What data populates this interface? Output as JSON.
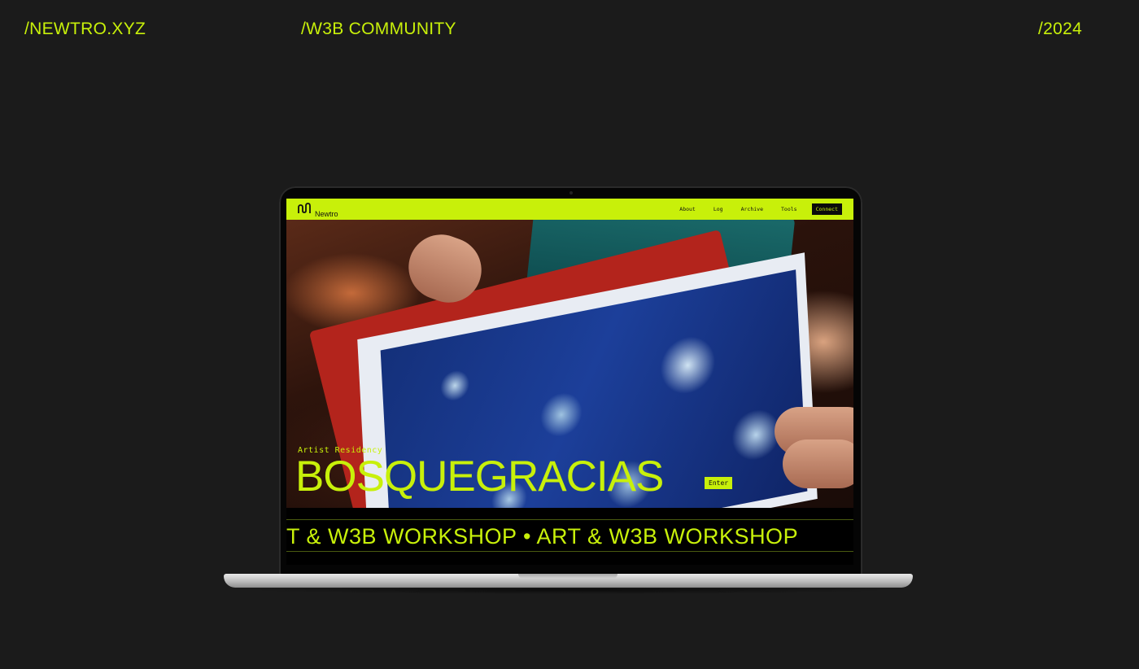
{
  "labels": {
    "left": "/NEWTRO.XYZ",
    "middle": "/W3B COMMUNITY",
    "right": "/2024"
  },
  "site": {
    "logo_text": "Newtro",
    "logo_icon": "newtro-logo-icon",
    "nav": {
      "items": [
        "About",
        "Log",
        "Archive",
        "Tools"
      ],
      "connect_label": "Connect"
    },
    "hero": {
      "caption": "Artist Residency",
      "title": "BOSQUEGRACIAS",
      "enter_label": "Enter"
    },
    "marquee": {
      "text": "T & W3B WORKSHOP • ART & W3B WORKSHOP"
    }
  },
  "colors": {
    "accent": "#c8f00a",
    "background": "#1b1b1b"
  }
}
